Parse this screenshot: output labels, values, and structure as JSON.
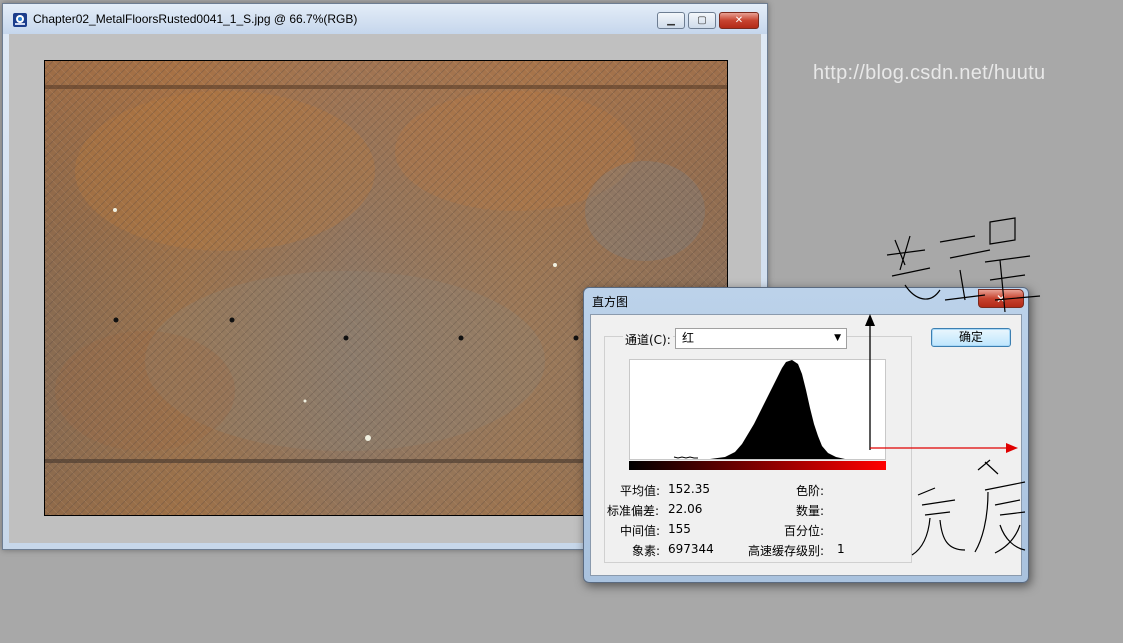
{
  "document_window": {
    "title": "Chapter02_MetalFloorsRusted0041_1_S.jpg @ 66.7%(RGB)",
    "icons": [
      "photoshop-icon",
      "minimize-icon",
      "maximize-icon",
      "close-icon"
    ]
  },
  "histogram_dialog": {
    "title": "直方图",
    "channel_label": "通道(C):",
    "channel_value": "红",
    "ok_label": "确定",
    "stats_left": [
      {
        "label": "平均值:",
        "value": "152.35"
      },
      {
        "label": "标准偏差:",
        "value": "22.06"
      },
      {
        "label": "中间值:",
        "value": "155"
      },
      {
        "label": "象素:",
        "value": "697344"
      }
    ],
    "stats_right": [
      {
        "label": "色阶:",
        "value": ""
      },
      {
        "label": "数量:",
        "value": ""
      },
      {
        "label": "百分位:",
        "value": ""
      },
      {
        "label": "高速缓存级别:",
        "value": "1"
      }
    ]
  },
  "watermark": "http://blog.csdn.net/huutu",
  "colors": {
    "desktop": "#a8a8a8",
    "canvas": "#c0c0c0",
    "close_red": "#c7432f",
    "annotation_red": "#e00000"
  }
}
